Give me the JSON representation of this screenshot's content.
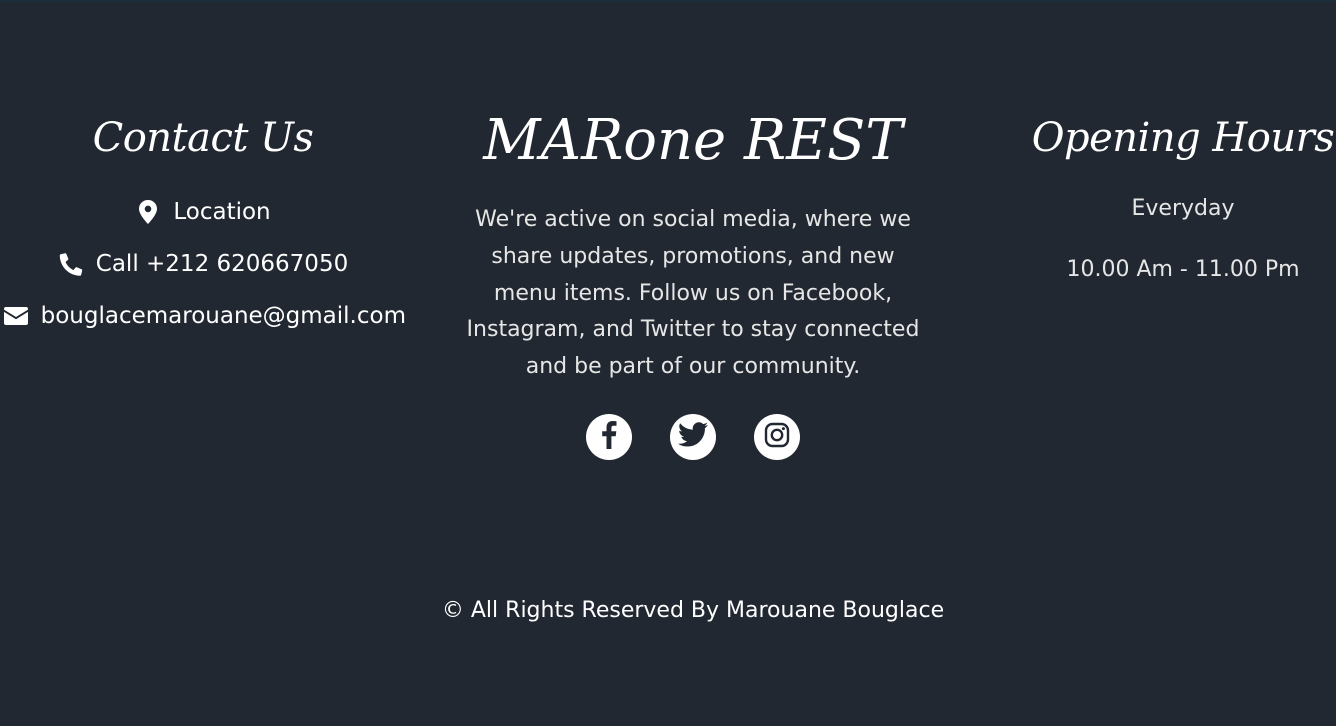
{
  "contact": {
    "title": "Contact Us",
    "location_label": "Location",
    "phone_label": "Call +212 620667050",
    "email_label": "bouglacemarouane@gmail.com",
    "icons": [
      "map-marker-icon",
      "phone-icon",
      "envelope-icon"
    ]
  },
  "brand": {
    "title": "MARone REST",
    "description": "We're active on social media, where we share updates, promotions, and new menu items. Follow us on Facebook, Instagram, and Twitter to stay connected and be part of our community.",
    "social": [
      {
        "name": "facebook",
        "icon": "facebook-icon"
      },
      {
        "name": "twitter",
        "icon": "twitter-icon"
      },
      {
        "name": "instagram",
        "icon": "instagram-icon"
      }
    ]
  },
  "hours": {
    "title": "Opening Hours",
    "day": "Everyday",
    "time": "10.00 Am - 11.00 Pm"
  },
  "footer": {
    "copyright": "© All Rights Reserved By Marouane Bouglace"
  },
  "colors": {
    "background": "#222831",
    "text": "#ffffff",
    "muted_text": "#e6e6e6",
    "social_icon": "#222831"
  }
}
